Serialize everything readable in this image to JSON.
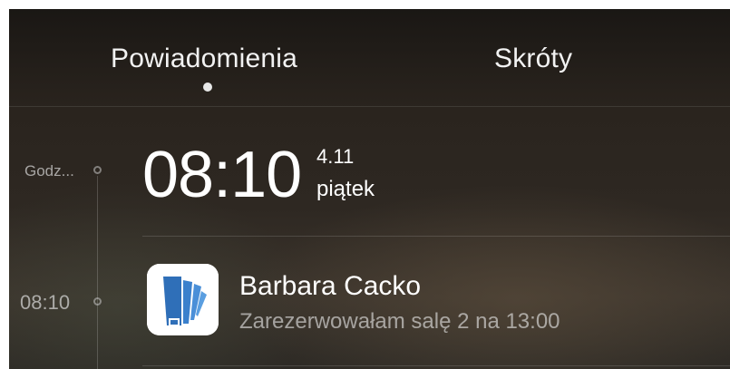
{
  "tabs": {
    "items": [
      {
        "label": "Powiadomienia",
        "active": true
      },
      {
        "label": "Skróty",
        "active": false
      }
    ]
  },
  "timeline": {
    "clock_label": "Godz...",
    "notification_time": "08:10"
  },
  "clock": {
    "time": "08:10",
    "date": "4.11",
    "weekday": "piątek"
  },
  "notification": {
    "sender": "Barbara Cacko",
    "message": "Zarezerwowałam salę 2 na 13:00",
    "app_icon": "notes-app-icon",
    "app_icon_color": "#2f6fb8"
  },
  "colors": {
    "background_top": "#1a1714",
    "background_bottom": "#3b342c",
    "text_primary": "#ffffff",
    "text_secondary": "#a8a6a2"
  }
}
